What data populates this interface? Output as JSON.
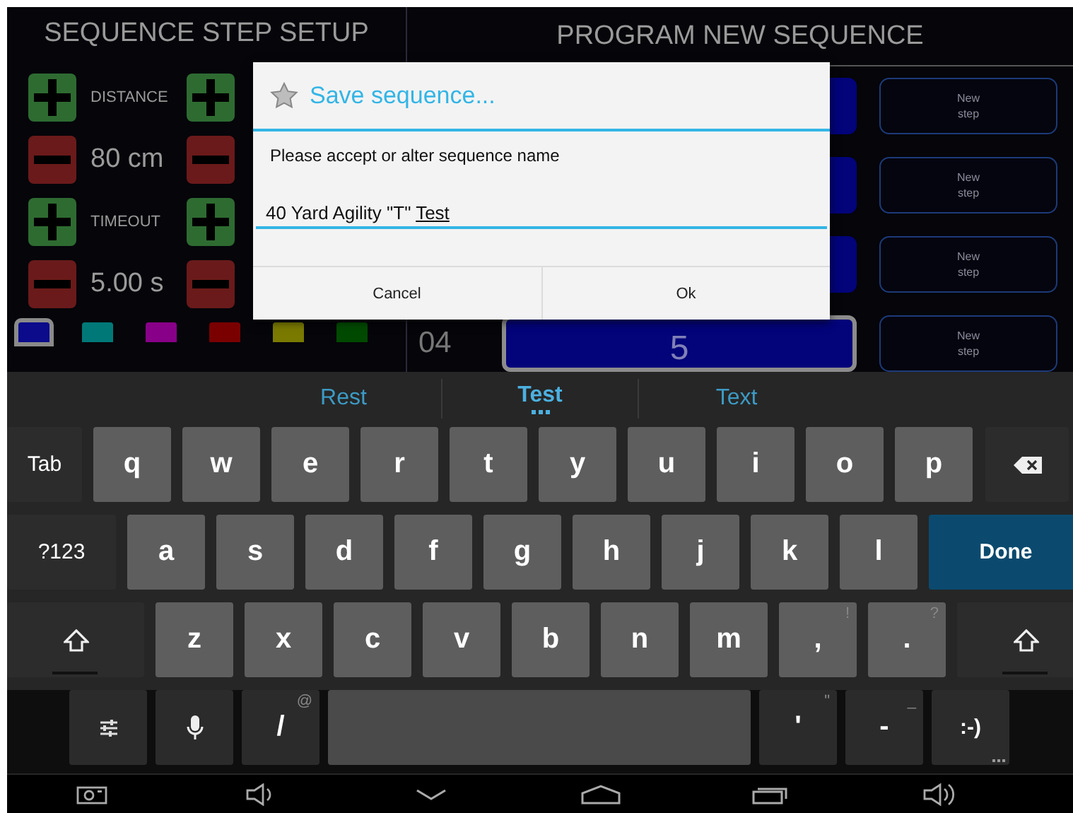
{
  "step_setup": {
    "title": "SEQUENCE STEP SETUP",
    "controls": [
      {
        "label": "DISTANCE",
        "value": "80 cm"
      },
      {
        "label": "TIMEOUT",
        "value": "5.00 s"
      }
    ],
    "swatches": [
      {
        "color": "#0b0b8c",
        "selected": true
      },
      {
        "color": "#007878",
        "selected": false
      },
      {
        "color": "#880088",
        "selected": false
      },
      {
        "color": "#7a0000",
        "selected": false
      },
      {
        "color": "#7a7a00",
        "selected": false
      },
      {
        "color": "#004a00",
        "selected": false
      }
    ]
  },
  "program": {
    "title": "PROGRAM NEW SEQUENCE",
    "rows": [
      {
        "selected": false,
        "new_step": "New\nstep"
      },
      {
        "selected": false,
        "new_step": "New\nstep"
      },
      {
        "selected": false,
        "new_step": "New\nstep"
      },
      {
        "selected": true,
        "number": "04",
        "value": "5",
        "new_step": "New\nstep"
      }
    ]
  },
  "dialog": {
    "title": "Save sequence...",
    "message": "Please accept or alter sequence name",
    "value": "40 Yard Agility \"T\" **Test**",
    "buttons": [
      "Cancel",
      "Ok"
    ]
  },
  "keyboard": {
    "suggestions": [
      {
        "text": "Rest",
        "selected": false
      },
      {
        "text": "Test",
        "selected": true
      },
      {
        "text": "Text",
        "selected": false
      }
    ],
    "rows": [
      {
        "keys": [
          {
            "kind": "tab",
            "label": "Tab"
          },
          {
            "kind": "letter",
            "label": "q"
          },
          {
            "kind": "letter",
            "label": "w"
          },
          {
            "kind": "letter",
            "label": "e"
          },
          {
            "kind": "letter",
            "label": "r"
          },
          {
            "kind": "letter",
            "label": "t"
          },
          {
            "kind": "letter",
            "label": "y"
          },
          {
            "kind": "letter",
            "label": "u"
          },
          {
            "kind": "letter",
            "label": "i"
          },
          {
            "kind": "letter",
            "label": "o"
          },
          {
            "kind": "letter",
            "label": "p"
          },
          {
            "kind": "backspace"
          }
        ]
      },
      {
        "keys": [
          {
            "kind": "symbols",
            "label": "?123"
          },
          {
            "kind": "letter",
            "label": "a"
          },
          {
            "kind": "letter",
            "label": "s"
          },
          {
            "kind": "letter",
            "label": "d"
          },
          {
            "kind": "letter",
            "label": "f"
          },
          {
            "kind": "letter",
            "label": "g"
          },
          {
            "kind": "letter",
            "label": "h"
          },
          {
            "kind": "letter",
            "label": "j"
          },
          {
            "kind": "letter",
            "label": "k"
          },
          {
            "kind": "letter",
            "label": "l"
          },
          {
            "kind": "done",
            "label": "Done"
          }
        ]
      },
      {
        "keys": [
          {
            "kind": "shift"
          },
          {
            "kind": "letter",
            "label": "z"
          },
          {
            "kind": "letter",
            "label": "x"
          },
          {
            "kind": "letter",
            "label": "c"
          },
          {
            "kind": "letter",
            "label": "v"
          },
          {
            "kind": "letter",
            "label": "b"
          },
          {
            "kind": "letter",
            "label": "n"
          },
          {
            "kind": "letter",
            "label": "m"
          },
          {
            "kind": "letter",
            "label": ",",
            "hint": "!"
          },
          {
            "kind": "letter",
            "label": ".",
            "hint": "?"
          },
          {
            "kind": "shift"
          }
        ]
      },
      {
        "keys": [
          {
            "kind": "settings"
          },
          {
            "kind": "mic"
          },
          {
            "kind": "dark",
            "label": "/",
            "hint": "@"
          },
          {
            "kind": "space"
          },
          {
            "kind": "dark",
            "label": "'",
            "hint": "\""
          },
          {
            "kind": "dark",
            "label": "-",
            "hint": "_"
          },
          {
            "kind": "smiley",
            "label": ":-)"
          }
        ]
      }
    ]
  },
  "nav_bar": [
    {
      "kind": "camera"
    },
    {
      "kind": "volume-down"
    },
    {
      "kind": "hide"
    },
    {
      "kind": "home"
    },
    {
      "kind": "recents"
    },
    {
      "kind": "volume-up"
    }
  ]
}
